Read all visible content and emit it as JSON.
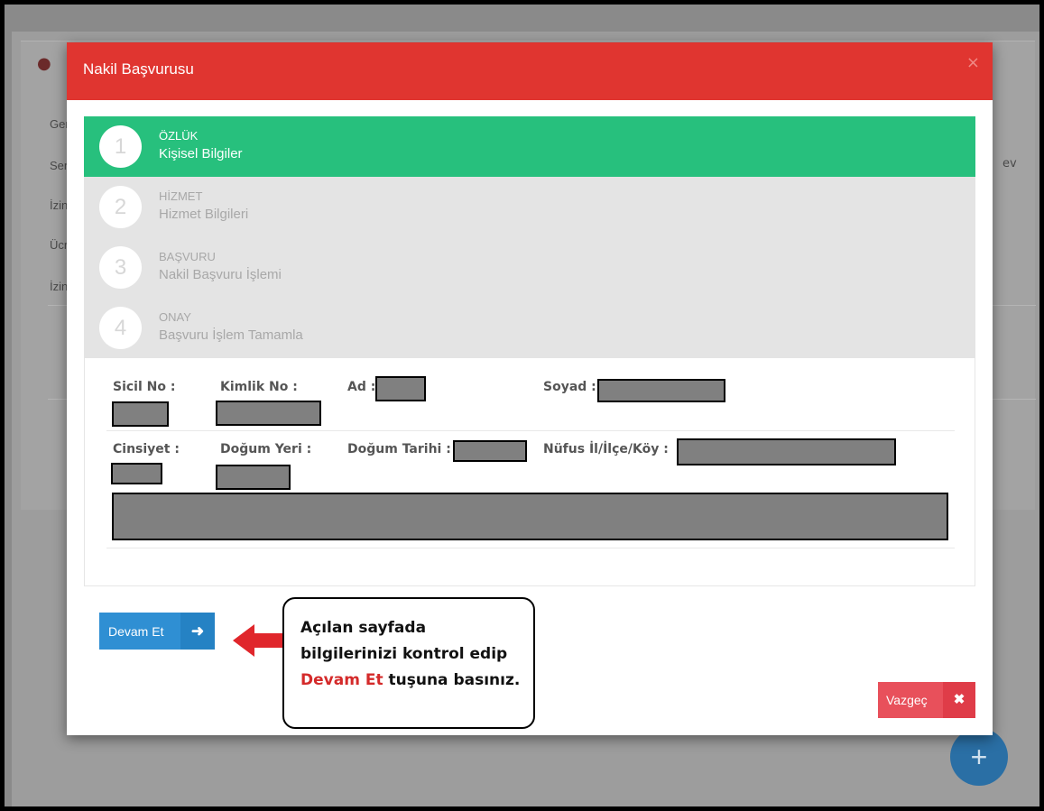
{
  "background": {
    "items": [
      "Gen",
      "Sen",
      "İzin",
      "Ücr",
      "İzin"
    ],
    "right_text": "ev",
    "fab_label": "+"
  },
  "modal": {
    "title": "Nakil Başvurusu",
    "close_label": "×",
    "steps": [
      {
        "num": "1",
        "title": "ÖZLÜK",
        "subtitle": "Kişisel Bilgiler",
        "active": true
      },
      {
        "num": "2",
        "title": "HİZMET",
        "subtitle": "Hizmet Bilgileri",
        "active": false
      },
      {
        "num": "3",
        "title": "BAŞVURU",
        "subtitle": "Nakil Başvuru İşlemi",
        "active": false
      },
      {
        "num": "4",
        "title": "ONAY",
        "subtitle": "Başvuru İşlem Tamamla",
        "active": false
      }
    ],
    "fields": {
      "sicil_no": "Sicil No :",
      "kimlik_no": "Kimlik No :",
      "ad": "Ad :",
      "soyad": "Soyad :",
      "cinsiyet": "Cinsiyet :",
      "dogum_yeri": "Doğum Yeri :",
      "dogum_tarihi": "Doğum Tarihi :",
      "nufus": "Nüfus İl/İlçe/Köy :"
    },
    "next_button": "Devam Et",
    "cancel_button": "Vazgeç"
  },
  "callout": {
    "line1": "Açılan sayfada",
    "line2": "bilgilerinizi kontrol edip",
    "highlight": "Devam Et",
    "line3_rest": " tuşuna basınız."
  },
  "colors": {
    "header": "#e03530",
    "active_step": "#27c07d",
    "next_button": "#2f8fd3",
    "cancel_button": "#e8505b",
    "callout_highlight": "#d42a2a"
  }
}
